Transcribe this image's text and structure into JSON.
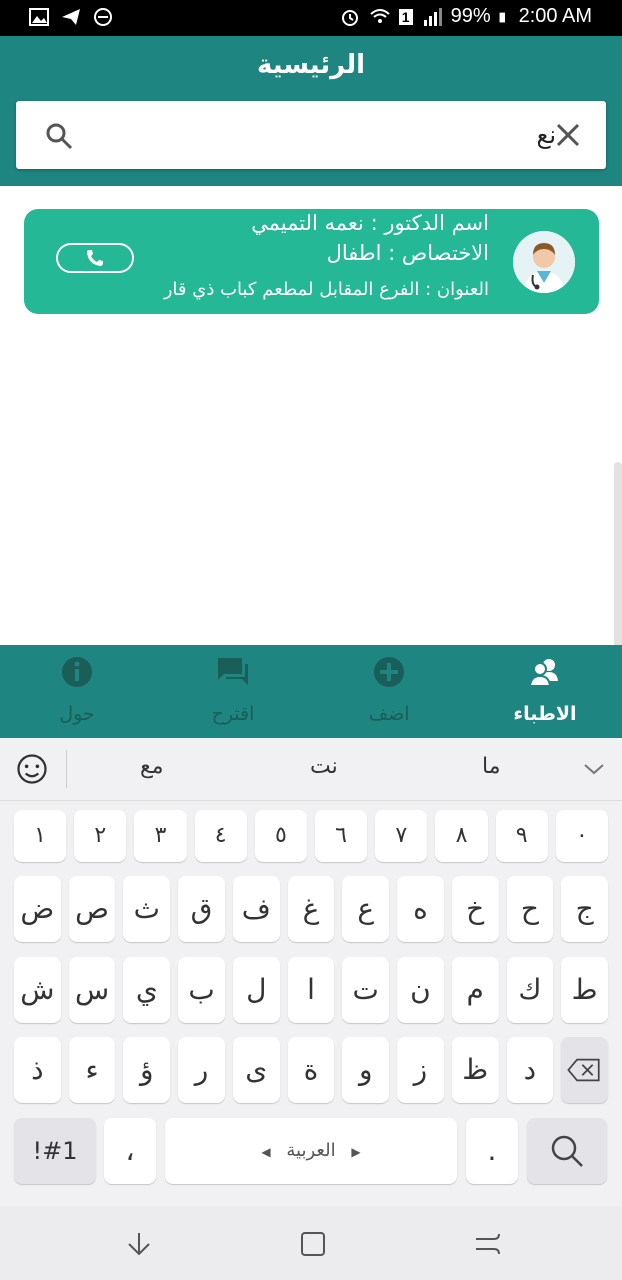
{
  "status_bar": {
    "battery": "99%",
    "time": "2:00 AM",
    "sim_badge": "1"
  },
  "header": {
    "title": "الرئيسية"
  },
  "search": {
    "value": "نع",
    "placeholder": ""
  },
  "doctors": [
    {
      "name_line": "اسم الدكتور : نعمه التميمي",
      "specialty_line": "الاختصاص : اطفال",
      "address_line": "العنوان : الفرع المقابل لمطعم كباب ذي قار"
    }
  ],
  "bottom_nav": {
    "items": [
      {
        "label": "الاطباء",
        "icon": "doctors-icon",
        "active": true
      },
      {
        "label": "اضف",
        "icon": "add-circle-icon",
        "active": false
      },
      {
        "label": "اقترح",
        "icon": "suggest-chat-icon",
        "active": false
      },
      {
        "label": "حول",
        "icon": "info-icon",
        "active": false
      }
    ]
  },
  "keyboard": {
    "suggestions": [
      "ما",
      "نت",
      "مع"
    ],
    "row_digits": [
      "١",
      "٢",
      "٣",
      "٤",
      "٥",
      "٦",
      "٧",
      "٨",
      "٩",
      "٠"
    ],
    "row1": [
      "ض",
      "ص",
      "ث",
      "ق",
      "ف",
      "غ",
      "ع",
      "ه",
      "خ",
      "ح",
      "ج"
    ],
    "row2": [
      "ش",
      "س",
      "ي",
      "ب",
      "ل",
      "ا",
      "ت",
      "ن",
      "م",
      "ك",
      "ط"
    ],
    "row3": [
      "ذ",
      "ء",
      "ؤ",
      "ر",
      "ى",
      "ة",
      "و",
      "ز",
      "ظ",
      "د"
    ],
    "symbols_key": "!#1",
    "comma_key": "،",
    "space_label": "العربية",
    "period_key": "."
  },
  "colors": {
    "header": "#1f8580",
    "card": "#25b896",
    "nav_inactive": "#1a5e59",
    "nav_active": "#ffffff"
  }
}
